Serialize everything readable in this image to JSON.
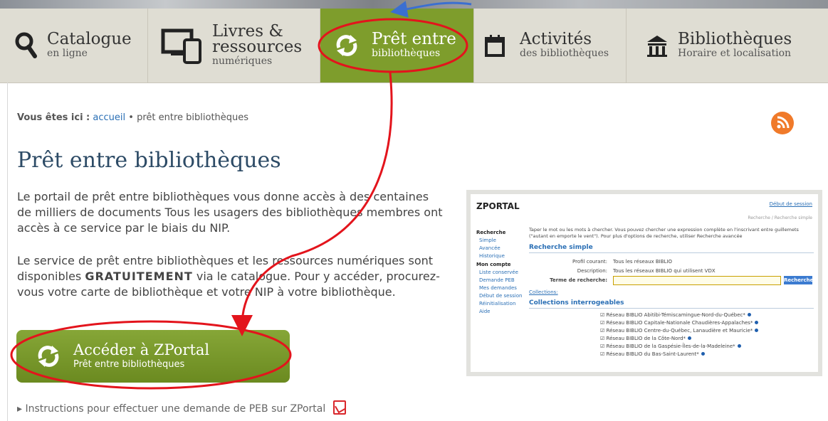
{
  "nav": [
    {
      "title": "Catalogue",
      "subtitle": "en ligne",
      "icon": "magnifier-icon"
    },
    {
      "title_line1": "Livres &",
      "title_line2": "ressources",
      "subtitle": "numériques",
      "icon": "devices-icon"
    },
    {
      "title": "Prêt entre",
      "subtitle": "bibliothèques",
      "icon": "exchange-arrows-icon",
      "active": true
    },
    {
      "title": "Activités",
      "subtitle": "des bibliothèques",
      "icon": "calendar-icon"
    },
    {
      "title": "Bibliothèques",
      "subtitle": "Horaire et localisation",
      "icon": "library-building-icon"
    }
  ],
  "breadcrumb": {
    "label": "Vous êtes ici :",
    "home": "accueil",
    "separator": "•",
    "current": "prêt entre bibliothèques"
  },
  "page_title": "Prêt entre bibliothèques",
  "intro": {
    "p1": "Le portail de prêt entre bibliothèques vous donne accès à des centaines de milliers de documents Tous les usagers des bibliothèques membres ont accès à ce service par le biais du NIP.",
    "p2_before": "Le service de prêt entre bibliothèques et les ressources numériques sont disponibles",
    "p2_bold": "GRATUITEMENT",
    "p2_after": "via le catalogue. Pour y accéder, procurez-vous votre carte de bibliothèque et votre NIP à votre bibliothèque."
  },
  "zportal_button": {
    "title": "Accéder à ZPortal",
    "subtitle": "Prêt entre bibliothèques"
  },
  "instructions_link": "Instructions pour effectuer une demande de PEB sur ZPortal",
  "zportal_screenshot": {
    "logo": "ZPORTAL",
    "session_link": "Début de session",
    "crumb": "Recherche / Recherche simple",
    "sidebar": [
      {
        "heading": "Recherche",
        "items": [
          "Simple",
          "Avancée",
          "Historique"
        ]
      },
      {
        "heading": "Mon compte",
        "items": [
          "Liste conservée",
          "Demande PEB",
          "Mes demandes",
          "Début de session",
          "Réinitialisation",
          "Aide"
        ]
      }
    ],
    "help_text": "Taper le mot ou les mots à chercher. Vous pouvez chercher une expression complète en l'inscrivant entre guillemets (\"autant en emporte le vent\"). Pour plus d'options de recherche, utiliser Recherche avancée",
    "simple_heading": "Recherche simple",
    "profile_label": "Profil courant:",
    "profile_value": "Tous les réseaux BIBLIO",
    "description_label": "Description:",
    "description_value": "Tous les réseaux BIBLIO qui utilisent VDX",
    "term_label": "Terme de recherche:",
    "search_button": "Recherche",
    "collections_link": "Collections:",
    "collections_heading": "Collections interrogeables",
    "collections": [
      "Réseau BIBLIO Abitibi-Témiscamingue-Nord-du-Québec*",
      "Réseau BIBLIO Capitale-Nationale Chaudières-Appalaches*",
      "Réseau BIBLIO Centre-du-Québec, Lanaudière et Mauricie*",
      "Réseau BIBLIO de la Côte-Nord*",
      "Réseau BIBLIO de la Gaspésie-Îles-de-la-Madeleine*",
      "Réseau BIBLIO du Bas-Saint-Laurent*"
    ]
  },
  "colors": {
    "nav_bg": "#dfddd3",
    "nav_active": "#7e9d2c",
    "title_blue": "#2d4b66",
    "link": "#2a6fb5",
    "annotation_red": "#e3141c"
  }
}
